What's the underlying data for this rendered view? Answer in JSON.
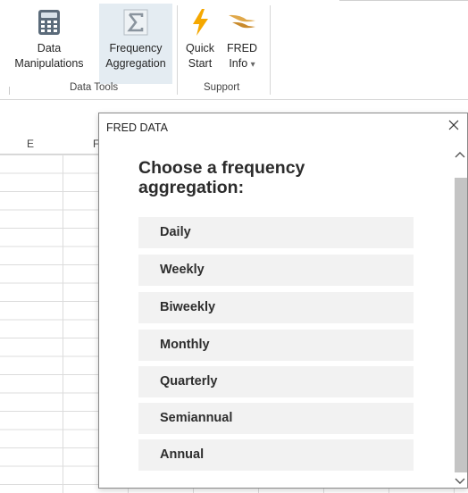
{
  "ribbon": {
    "groups": [
      {
        "label": "Data Tools"
      },
      {
        "label": "Support"
      }
    ],
    "buttons": {
      "data_manipulations": {
        "line1": "Data",
        "line2": "Manipulations",
        "icon": "calculator-icon"
      },
      "frequency_aggregation": {
        "line1": "Frequency",
        "line2": "Aggregation",
        "icon": "sigma-icon"
      },
      "quick_start": {
        "line1": "Quick",
        "line2": "Start",
        "icon": "lightning-icon"
      },
      "fred_info": {
        "line1": "FRED",
        "line2": "Info",
        "dropdown_glyph": "▾",
        "icon": "fred-logo-icon"
      }
    }
  },
  "sheet": {
    "columns": [
      "E",
      "F"
    ]
  },
  "pane": {
    "title": "FRED DATA",
    "close_glyph": "✕",
    "heading": "Choose a frequency aggregation:",
    "options": [
      "Daily",
      "Weekly",
      "Biweekly",
      "Monthly",
      "Quarterly",
      "Semiannual",
      "Annual"
    ]
  },
  "colors": {
    "selected_button_bg": "#e4ecf2",
    "option_bg": "#f2f2f2",
    "lightning": "#f5a800",
    "scroll_thumb": "#c4c4c4"
  }
}
